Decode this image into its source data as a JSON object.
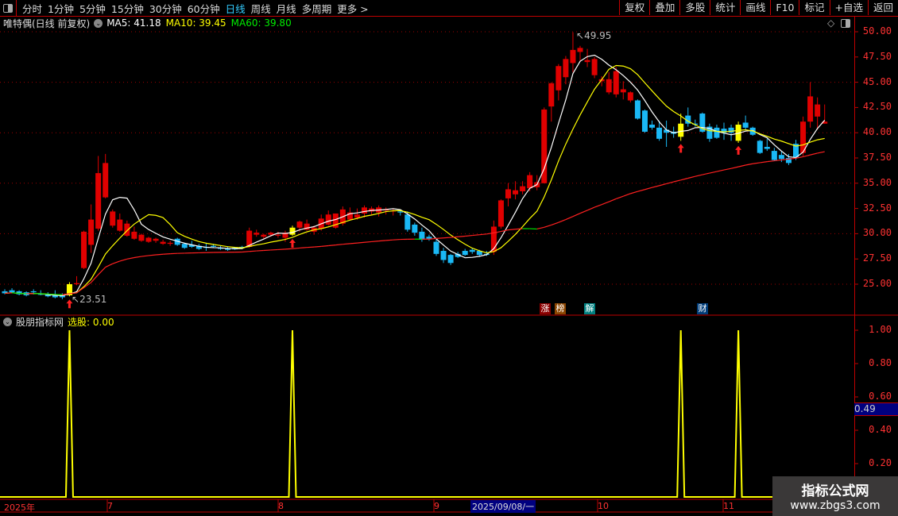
{
  "toolbar": {
    "periods": [
      "分时",
      "1分钟",
      "5分钟",
      "15分钟",
      "30分钟",
      "60分钟",
      "日线",
      "周线",
      "月线",
      "多周期",
      "更多 >"
    ],
    "active_period": "日线",
    "buttons": [
      "复权",
      "叠加",
      "多股",
      "统计",
      "画线",
      "F10",
      "标记",
      "+自选",
      "返回"
    ]
  },
  "main": {
    "title": "唯特偶(日线 前复权)",
    "ma5": "MA5: 41.18",
    "ma10": "MA10: 39.45",
    "ma60": "MA60: 39.80",
    "high_label": "49.95",
    "low_label": "23.51",
    "price_ticks": [
      "50.00",
      "47.50",
      "45.00",
      "42.50",
      "40.00",
      "37.50",
      "35.00",
      "32.50",
      "30.00",
      "27.50",
      "25.00"
    ],
    "tags": [
      {
        "text": "涨",
        "color": "#8b0000"
      },
      {
        "text": "榜",
        "color": "#8b4500"
      },
      {
        "text": "解",
        "color": "#008080"
      },
      {
        "text": "财",
        "color": "#003c78"
      }
    ]
  },
  "indicator": {
    "name": "股朋指标网",
    "value_label": "选股: 0.00",
    "ticks": [
      "1.00",
      "0.80",
      "0.60",
      "0.40",
      "0.20"
    ],
    "cursor_value": "0.49"
  },
  "time_axis": {
    "labels": [
      "2025年",
      "7",
      "8",
      "9",
      "10",
      "11"
    ],
    "cursor_date": "2025/09/08/一"
  },
  "watermark": {
    "line1": "指标公式网",
    "line2": "www.zbgs3.com"
  },
  "colors": {
    "up": "#e00000",
    "down": "#1ab8f5",
    "signal": "#ffff00",
    "ma5": "#ffffff",
    "ma10": "#ffff00",
    "ma60_up": "#ff2020",
    "ma60_down": "#00e000",
    "axis": "#c00000"
  },
  "chart_data": {
    "type": "candlestick",
    "ylim": [
      23,
      51
    ],
    "candles": [
      [
        24.3,
        24.5,
        24.0,
        24.1
      ],
      [
        24.4,
        24.6,
        24.1,
        24.2
      ],
      [
        24.3,
        24.4,
        23.9,
        24.0
      ],
      [
        24.2,
        24.3,
        23.8,
        23.9
      ],
      [
        24.3,
        24.5,
        24.0,
        24.2
      ],
      [
        24.1,
        24.4,
        23.9,
        23.95
      ],
      [
        24.0,
        24.2,
        23.7,
        23.8
      ],
      [
        23.9,
        24.4,
        23.6,
        23.7
      ],
      [
        24.0,
        24.1,
        23.51,
        23.7
      ],
      [
        23.9,
        25.2,
        23.8,
        25.0
      ],
      [
        25.0,
        25.8,
        24.9,
        25.1
      ],
      [
        26.6,
        30.3,
        26.5,
        30.2
      ],
      [
        28.9,
        32.9,
        28.1,
        31.4
      ],
      [
        30.5,
        37.7,
        30.3,
        36.0
      ],
      [
        33.6,
        37.9,
        33.5,
        37.0
      ],
      [
        30.8,
        32.4,
        30.6,
        32.2
      ],
      [
        30.3,
        32.0,
        30.2,
        31.4
      ],
      [
        29.8,
        31.3,
        29.7,
        31.0
      ],
      [
        29.5,
        30.7,
        29.4,
        30.2
      ],
      [
        29.3,
        30.0,
        29.2,
        29.9
      ],
      [
        29.2,
        29.7,
        29.1,
        29.6
      ],
      [
        29.3,
        29.6,
        29.1,
        29.5
      ],
      [
        29.0,
        29.4,
        28.9,
        29.2
      ],
      [
        29.0,
        29.3,
        28.8,
        29.1
      ],
      [
        29.5,
        29.6,
        28.8,
        28.9
      ],
      [
        29.0,
        29.1,
        28.5,
        28.6
      ],
      [
        28.9,
        29.3,
        28.6,
        28.7
      ],
      [
        28.8,
        29.0,
        28.4,
        28.5
      ],
      [
        28.7,
        29.1,
        28.3,
        28.6
      ],
      [
        28.8,
        29.0,
        28.6,
        28.7
      ],
      [
        28.6,
        28.8,
        28.4,
        28.5
      ],
      [
        28.5,
        28.7,
        28.3,
        28.4
      ],
      [
        28.6,
        28.7,
        28.4,
        28.45
      ],
      [
        28.7,
        28.8,
        28.5,
        28.6
      ],
      [
        28.7,
        30.6,
        28.6,
        30.3
      ],
      [
        29.9,
        30.4,
        29.7,
        30.1
      ],
      [
        29.7,
        30.0,
        29.5,
        29.9
      ],
      [
        29.9,
        30.2,
        29.7,
        30.1
      ],
      [
        29.8,
        30.2,
        29.6,
        29.9
      ],
      [
        29.6,
        30.3,
        29.2,
        30.1
      ],
      [
        29.9,
        30.8,
        29.8,
        30.6
      ],
      [
        30.6,
        31.3,
        30.2,
        31.2
      ],
      [
        30.4,
        31.4,
        30.3,
        31.0
      ],
      [
        30.2,
        30.8,
        29.9,
        30.6
      ],
      [
        30.5,
        31.9,
        30.3,
        31.5
      ],
      [
        30.9,
        32.3,
        30.8,
        31.9
      ],
      [
        30.6,
        32.0,
        30.5,
        32.0
      ],
      [
        31.0,
        32.7,
        30.8,
        32.4
      ],
      [
        31.4,
        32.6,
        31.3,
        32.1
      ],
      [
        31.6,
        32.5,
        31.4,
        31.9
      ],
      [
        32.0,
        32.8,
        31.6,
        32.6
      ],
      [
        32.2,
        32.7,
        31.9,
        32.5
      ],
      [
        32.1,
        32.8,
        31.7,
        32.6
      ],
      [
        32.3,
        32.6,
        31.9,
        32.4
      ],
      [
        32.2,
        32.5,
        31.8,
        32.3
      ],
      [
        32.2,
        32.4,
        31.8,
        32.1
      ],
      [
        31.9,
        32.2,
        30.2,
        30.4
      ],
      [
        30.9,
        31.1,
        29.8,
        30.1
      ],
      [
        30.2,
        30.6,
        29.2,
        29.4
      ],
      [
        29.7,
        29.9,
        29.3,
        29.5
      ],
      [
        29.2,
        29.4,
        27.8,
        28.0
      ],
      [
        28.3,
        28.6,
        27.1,
        27.4
      ],
      [
        27.9,
        28.0,
        26.9,
        27.1
      ],
      [
        28.0,
        28.2,
        27.6,
        27.7
      ],
      [
        28.3,
        28.5,
        27.8,
        27.9
      ],
      [
        28.4,
        28.6,
        28.0,
        28.2
      ],
      [
        28.3,
        28.4,
        27.7,
        27.9
      ],
      [
        28.0,
        28.3,
        27.8,
        27.9
      ],
      [
        28.2,
        31.3,
        27.9,
        30.7
      ],
      [
        30.7,
        33.4,
        30.5,
        33.3
      ],
      [
        33.5,
        35.0,
        32.7,
        34.4
      ],
      [
        33.9,
        35.2,
        33.4,
        34.3
      ],
      [
        34.2,
        35.2,
        33.9,
        34.7
      ],
      [
        34.5,
        36.1,
        34.2,
        35.8
      ],
      [
        34.6,
        35.8,
        34.3,
        35.1
      ],
      [
        35.0,
        42.5,
        35.0,
        42.3
      ],
      [
        42.6,
        45.0,
        41.1,
        44.9
      ],
      [
        44.2,
        46.8,
        43.2,
        46.6
      ],
      [
        45.5,
        47.6,
        44.8,
        47.3
      ],
      [
        46.9,
        49.95,
        46.0,
        48.2
      ],
      [
        48.0,
        48.6,
        47.0,
        48.4
      ],
      [
        47.0,
        48.3,
        46.5,
        47.2
      ],
      [
        45.7,
        47.5,
        45.4,
        47.3
      ],
      [
        45.1,
        45.6,
        44.6,
        45.3
      ],
      [
        44.0,
        46.0,
        43.8,
        45.3
      ],
      [
        43.8,
        46.5,
        43.5,
        46.1
      ],
      [
        44.0,
        45.1,
        43.3,
        44.3
      ],
      [
        43.2,
        44.1,
        43.0,
        44.0
      ],
      [
        43.2,
        43.3,
        41.3,
        41.4
      ],
      [
        42.2,
        42.3,
        40.0,
        40.1
      ],
      [
        40.8,
        41.2,
        40.3,
        40.5
      ],
      [
        40.5,
        41.2,
        39.2,
        39.4
      ],
      [
        40.3,
        41.2,
        38.6,
        40.0
      ],
      [
        40.1,
        40.6,
        39.5,
        39.9
      ],
      [
        39.6,
        41.9,
        39.2,
        40.9
      ],
      [
        41.7,
        42.5,
        40.6,
        40.9
      ],
      [
        40.9,
        41.3,
        40.6,
        40.8
      ],
      [
        41.9,
        42.0,
        40.0,
        40.1
      ],
      [
        40.6,
        40.9,
        39.1,
        39.4
      ],
      [
        40.5,
        40.8,
        39.4,
        39.5
      ],
      [
        40.4,
        41.0,
        39.3,
        40.0
      ],
      [
        40.5,
        40.8,
        39.2,
        40.0
      ],
      [
        39.2,
        41.1,
        39.0,
        40.8
      ],
      [
        41.0,
        41.7,
        40.3,
        40.5
      ],
      [
        40.5,
        40.6,
        39.7,
        39.8
      ],
      [
        39.2,
        39.3,
        37.9,
        38.0
      ],
      [
        38.6,
        39.4,
        38.2,
        38.4
      ],
      [
        38.2,
        38.5,
        37.2,
        37.3
      ],
      [
        37.8,
        38.2,
        37.1,
        37.4
      ],
      [
        37.5,
        37.9,
        36.8,
        37.0
      ],
      [
        38.9,
        39.3,
        37.3,
        37.6
      ],
      [
        38.0,
        41.6,
        37.7,
        41.1
      ],
      [
        41.1,
        45.0,
        40.5,
        43.6
      ],
      [
        41.6,
        43.5,
        40.3,
        42.8
      ],
      [
        40.9,
        42.8,
        40.9,
        41.1
      ]
    ],
    "signal_indices": [
      9,
      40,
      94,
      102
    ],
    "indicator_ylim": [
      0,
      1
    ],
    "grid": "dotted every 5.00"
  }
}
